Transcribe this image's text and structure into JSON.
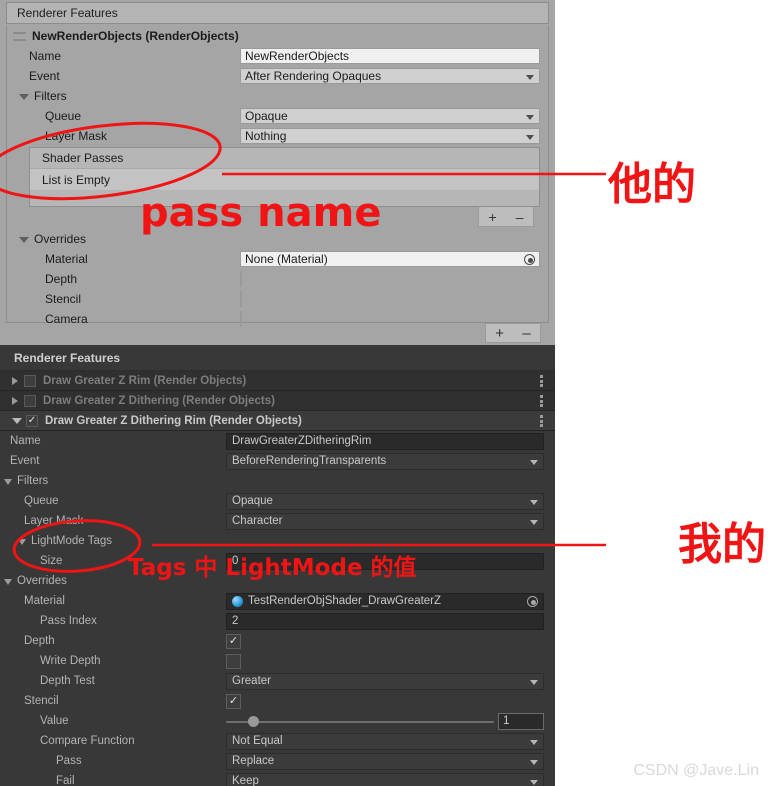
{
  "top_panel": {
    "title": "Renderer Features",
    "feature_header": "NewRenderObjects (RenderObjects)",
    "rows": {
      "name_label": "Name",
      "name_value": "NewRenderObjects",
      "event_label": "Event",
      "event_value": "After Rendering Opaques",
      "filters_label": "Filters",
      "queue_label": "Queue",
      "queue_value": "Opaque",
      "layer_mask_label": "Layer Mask",
      "layer_mask_value": "Nothing",
      "shader_passes_label": "Shader Passes",
      "list_empty_label": "List is Empty",
      "overrides_label": "Overrides",
      "material_label": "Material",
      "material_value": "None (Material)",
      "depth_label": "Depth",
      "stencil_label": "Stencil",
      "camera_label": "Camera"
    },
    "plus_label": "+",
    "minus_label": "–"
  },
  "bottom_panel": {
    "title": "Renderer Features",
    "features": [
      {
        "name": "Draw Greater Z Rim (Render Objects)",
        "enabled": false,
        "expanded": false
      },
      {
        "name": "Draw Greater Z Dithering (Render Objects)",
        "enabled": false,
        "expanded": false
      },
      {
        "name": "Draw Greater Z Dithering Rim (Render Objects)",
        "enabled": true,
        "expanded": true
      }
    ],
    "rows": {
      "name_label": "Name",
      "name_value": "DrawGreaterZDitheringRim",
      "event_label": "Event",
      "event_value": "BeforeRenderingTransparents",
      "filters_label": "Filters",
      "queue_label": "Queue",
      "queue_value": "Opaque",
      "layer_mask_label": "Layer Mask",
      "layer_mask_value": "Character",
      "lightmode_tags_label": "LightMode Tags",
      "size_label": "Size",
      "size_value": "0",
      "overrides_label": "Overrides",
      "material_label": "Material",
      "material_value": "TestRenderObjShader_DrawGreaterZ",
      "pass_index_label": "Pass Index",
      "pass_index_value": "2",
      "depth_label": "Depth",
      "write_depth_label": "Write Depth",
      "depth_test_label": "Depth Test",
      "depth_test_value": "Greater",
      "stencil_label": "Stencil",
      "value_label": "Value",
      "value_number": "1",
      "compare_function_label": "Compare Function",
      "compare_function_value": "Not Equal",
      "pass_label": "Pass",
      "pass_value": "Replace",
      "fail_label": "Fail",
      "fail_value": "Keep"
    }
  },
  "annotations": {
    "pass_name": "pass name",
    "his": "他的",
    "mine": "我的",
    "tags_lightmode": "Tags 中 LightMode 的值"
  },
  "watermark": "CSDN @Jave.Lin",
  "colors": {
    "annotation_red": "#f01414",
    "light_panel_bg": "#a5a5a5",
    "dark_panel_bg": "#383838"
  }
}
